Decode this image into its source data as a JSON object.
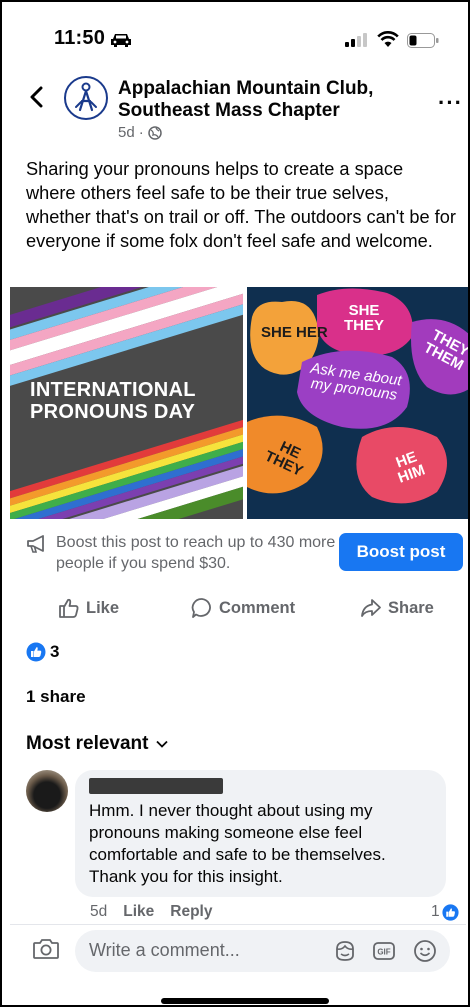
{
  "status_bar": {
    "time": "11:50"
  },
  "post": {
    "page_name": "Appalachian Mountain Club, Southeast Mass Chapter",
    "age": "5d",
    "audience_icon": "globe-icon",
    "text": "Sharing your pronouns helps to create a space where others feel safe to be their true selves, whether that's on trail or off. The outdoors can't be for everyone if some folx don't feel safe and welcome.",
    "image": {
      "title": "INTERNATIONAL PRONOUNS DAY",
      "bubbles": {
        "she_her": "SHE HER",
        "she_they": "SHE THEY",
        "they_them": "THEY THEM",
        "ask_me": "Ask me about my pronouns",
        "he_they": "HE THEY",
        "he_him": "HE HIM"
      }
    }
  },
  "boost": {
    "text": "Boost this post to reach up to 430 more people if you spend $30.",
    "button": "Boost post"
  },
  "actions": {
    "like": "Like",
    "comment": "Comment",
    "share": "Share"
  },
  "reactions": {
    "count": "3",
    "shares": "1 share"
  },
  "filter": {
    "label": "Most relevant"
  },
  "comment": {
    "text": "Hmm. I never thought about using my pronouns making someone else feel comfortable and safe to be themselves. Thank you for this insight.",
    "age": "5d",
    "like": "Like",
    "reply": "Reply",
    "like_count": "1"
  },
  "composer": {
    "placeholder": "Write a comment..."
  },
  "colors": {
    "accent": "#1877f2",
    "secondary_text": "#65676b",
    "bubble_bg": "#f0f2f5"
  }
}
